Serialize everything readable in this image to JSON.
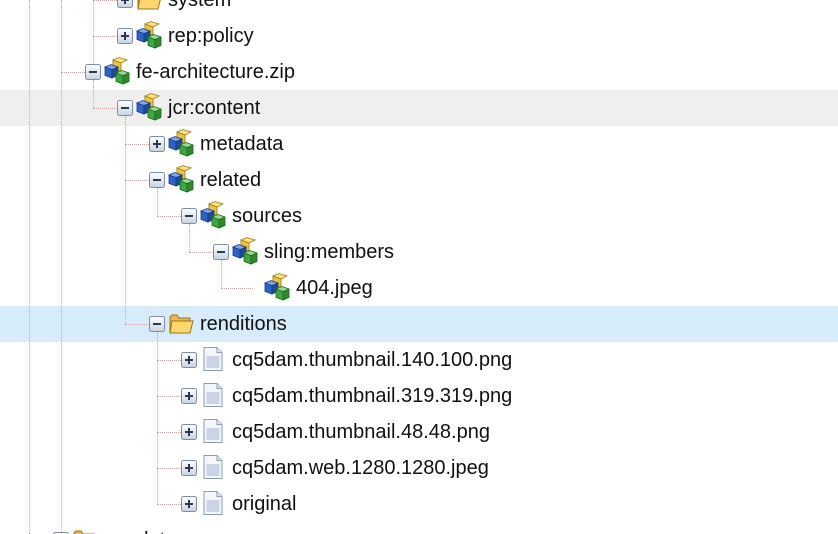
{
  "colors": {
    "hover_row": "#efefef",
    "selected_row": "#d7ecfa",
    "connector": "#c9a3a8"
  },
  "tree": {
    "nodes": [
      {
        "label": "system",
        "depth": 3,
        "toggle": "plus",
        "icon": "folder-icon",
        "connector": "tee"
      },
      {
        "label": "rep:policy",
        "depth": 3,
        "toggle": "plus",
        "icon": "node-icon",
        "connector": "corner"
      },
      {
        "label": "fe-architecture.zip",
        "depth": 2,
        "toggle": "minus",
        "icon": "node-icon",
        "connector": "tee"
      },
      {
        "label": "jcr:content",
        "depth": 3,
        "toggle": "minus",
        "icon": "node-icon",
        "connector": "corner",
        "state": "hover"
      },
      {
        "label": "metadata",
        "depth": 4,
        "toggle": "plus",
        "icon": "node-icon",
        "connector": "tee"
      },
      {
        "label": "related",
        "depth": 4,
        "toggle": "minus",
        "icon": "node-icon",
        "connector": "tee"
      },
      {
        "label": "sources",
        "depth": 5,
        "toggle": "minus",
        "icon": "node-icon",
        "connector": "corner"
      },
      {
        "label": "sling:members",
        "depth": 6,
        "toggle": "minus",
        "icon": "node-icon",
        "connector": "corner"
      },
      {
        "label": "404.jpeg",
        "depth": 7,
        "toggle": "none",
        "icon": "node-icon",
        "connector": "corner"
      },
      {
        "label": "renditions",
        "depth": 4,
        "toggle": "minus",
        "icon": "folder-icon",
        "connector": "corner",
        "state": "selected"
      },
      {
        "label": "cq5dam.thumbnail.140.100.png",
        "depth": 5,
        "toggle": "plus",
        "icon": "file-icon",
        "connector": "tee"
      },
      {
        "label": "cq5dam.thumbnail.319.319.png",
        "depth": 5,
        "toggle": "plus",
        "icon": "file-icon",
        "connector": "tee"
      },
      {
        "label": "cq5dam.thumbnail.48.48.png",
        "depth": 5,
        "toggle": "plus",
        "icon": "file-icon",
        "connector": "tee"
      },
      {
        "label": "cq5dam.web.1280.1280.jpeg",
        "depth": 5,
        "toggle": "plus",
        "icon": "file-icon",
        "connector": "tee"
      },
      {
        "label": "original",
        "depth": 5,
        "toggle": "plus",
        "icon": "file-icon",
        "connector": "corner"
      },
      {
        "label": "appdata",
        "depth": 1,
        "toggle": "minus",
        "icon": "folder-icon",
        "connector": "tee"
      }
    ]
  }
}
